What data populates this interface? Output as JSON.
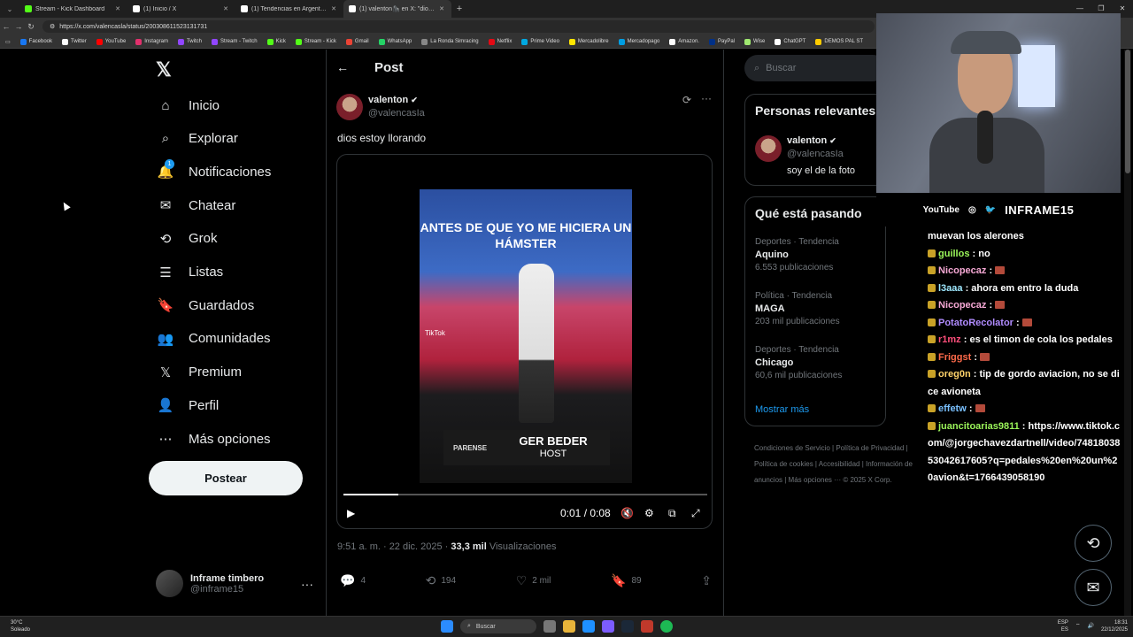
{
  "browser": {
    "tabs": [
      {
        "label": "Stream - Kick Dashboard",
        "color": "#53fc18",
        "active": false
      },
      {
        "label": "(1) Inicio / X",
        "color": "#ffffff",
        "active": false
      },
      {
        "label": "(1) Tendencias en Argentina (@pc",
        "color": "#ffffff",
        "active": false
      },
      {
        "label": "(1) valenton🦍 en X: \"dios estoy llo",
        "color": "#ffffff",
        "active": true
      }
    ],
    "url": "https://x.com/valencasla/status/2003086115231317​31",
    "bookmarks": [
      {
        "label": "Facebook",
        "color": "#1877f2"
      },
      {
        "label": "Twitter",
        "color": "#ffffff"
      },
      {
        "label": "YouTube",
        "color": "#ff0000"
      },
      {
        "label": "Instagram",
        "color": "#e1306c"
      },
      {
        "label": "Twitch",
        "color": "#9146ff"
      },
      {
        "label": "Stream - Twitch",
        "color": "#9146ff"
      },
      {
        "label": "Kick",
        "color": "#53fc18"
      },
      {
        "label": "Stream - Kick",
        "color": "#53fc18"
      },
      {
        "label": "Gmail",
        "color": "#ea4335"
      },
      {
        "label": "WhatsApp",
        "color": "#25d366"
      },
      {
        "label": "La Ronda Simracing",
        "color": "#888888"
      },
      {
        "label": "Netflix",
        "color": "#e50914"
      },
      {
        "label": "Prime Video",
        "color": "#00a8e1"
      },
      {
        "label": "Mercadolibre",
        "color": "#ffe600"
      },
      {
        "label": "Mercadopago",
        "color": "#009ee3"
      },
      {
        "label": "Amazon.",
        "color": "#ffffff"
      },
      {
        "label": "PayPal",
        "color": "#003087"
      },
      {
        "label": "Wise",
        "color": "#9fe870"
      },
      {
        "label": "ChatGPT",
        "color": "#ffffff"
      },
      {
        "label": "DEMOS PAL ST",
        "color": "#ffcc00"
      }
    ]
  },
  "nav": {
    "items": [
      {
        "label": "Inicio",
        "icon": "home-icon"
      },
      {
        "label": "Explorar",
        "icon": "search-icon"
      },
      {
        "label": "Notificaciones",
        "icon": "bell-icon"
      },
      {
        "label": "Chatear",
        "icon": "mail-icon"
      },
      {
        "label": "Grok",
        "icon": "grok-icon"
      },
      {
        "label": "Listas",
        "icon": "list-icon"
      },
      {
        "label": "Guardados",
        "icon": "bookmark-icon"
      },
      {
        "label": "Comunidades",
        "icon": "people-icon"
      },
      {
        "label": "Premium",
        "icon": "x-icon"
      },
      {
        "label": "Perfil",
        "icon": "user-icon"
      },
      {
        "label": "Más opciones",
        "icon": "more-circle-icon"
      }
    ],
    "notif_badge": "1",
    "post_button": "Postear",
    "account": {
      "name": "Inframe timbero",
      "handle": "@inframe15"
    }
  },
  "post": {
    "header": "Post",
    "author": {
      "name": "valenton",
      "handle": "@valencasIa"
    },
    "text": "dios estoy llorando",
    "video": {
      "caption": "ANTES DE QUE YO ME HICIERA UN HÁMSTER",
      "lower_left": "PARENSE",
      "lower_name": "GER BEDER",
      "lower_role": "HOST",
      "tiktok": "TikTok",
      "time": "0:01 / 0:08",
      "progress": 0.15
    },
    "timestamp": "9:51 a. m. · 22 dic. 2025 · ",
    "views": "33,3 mil",
    "views_label": " Visualizaciones",
    "stats": {
      "replies": "4",
      "reposts": "194",
      "likes": "2 mil",
      "bookmarks": "89"
    }
  },
  "sidebar": {
    "search_placeholder": "Buscar",
    "relevant_title": "Personas relevantes",
    "relevant": {
      "name": "valenton",
      "handle": "@valencasIa",
      "bio": "soy el de la foto"
    },
    "trends_title": "Qué está pasando",
    "trends": [
      {
        "category": "Deportes · Tendencia",
        "topic": "Aquino",
        "posts": "6.553 publicaciones"
      },
      {
        "category": "Política · Tendencia",
        "topic": "MAGA",
        "posts": "203 mil publicaciones"
      },
      {
        "category": "Deportes · Tendencia",
        "topic": "Chicago",
        "posts": "60,6 mil publicaciones"
      }
    ],
    "show_more": "Mostrar más",
    "footer": "Condiciones de Servicio  |  Política de Privacidad  |  Política de cookies  |  Accesibilidad  |  Información de anuncios  |  Más opciones ···  © 2025 X Corp."
  },
  "overlay": {
    "youtube": "YouTube",
    "brand": "INFRAME15",
    "chat": [
      {
        "user": "",
        "msg": "muevan los alerones",
        "color": "#ffffff"
      },
      {
        "user": "guillos",
        "msg": " : no",
        "color": "#9bf55a"
      },
      {
        "user": "Nicopecaz",
        "msg": " : ",
        "color": "#f5a8d4",
        "emote": true
      },
      {
        "user": "l3aaa",
        "msg": " : ahora em entro la duda",
        "color": "#9ee8ff"
      },
      {
        "user": "Nicopecaz",
        "msg": " : ",
        "color": "#f5a8d4",
        "emote": true
      },
      {
        "user": "PotatoRecolator",
        "msg": " : ",
        "color": "#b18cff",
        "emote": true
      },
      {
        "user": "r1mz",
        "msg": " : es el timon de cola los pedales",
        "color": "#ff4f7b"
      },
      {
        "user": "Friggst",
        "msg": " : ",
        "color": "#ff6a4a",
        "emote": true
      },
      {
        "user": "oreg0n",
        "msg": " : tip de gordo aviacion, no se dice avioneta",
        "color": "#ffd36a"
      },
      {
        "user": "effetw",
        "msg": " : ",
        "color": "#7ac1ff",
        "emote": true
      },
      {
        "user": "juancitoarias9811",
        "msg": " : https://www.tiktok.com/@jorgechavezdartnell/video/7481803853042617605?q=pedales%20en%20un%20avion&t=1766439058190",
        "color": "#9bf55a"
      }
    ]
  },
  "taskbar": {
    "weather_temp": "30°C",
    "weather_desc": "Soleado",
    "search": "Buscar",
    "lang1": "ESP",
    "lang2": "ES",
    "time": "18:31",
    "date": "22/12/2025"
  }
}
